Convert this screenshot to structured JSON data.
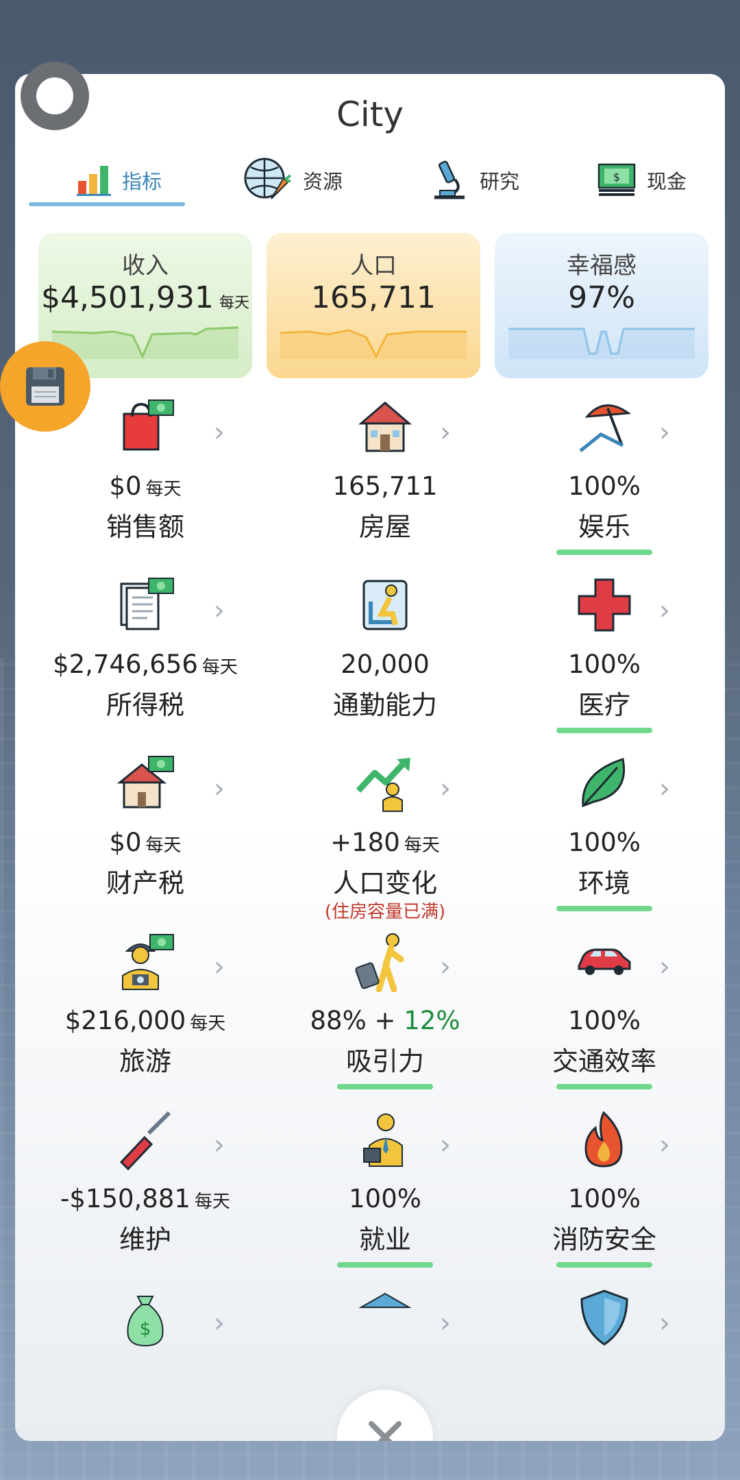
{
  "title": "City",
  "tabs": [
    {
      "label": "指标",
      "icon": "bar-chart-icon",
      "active": true
    },
    {
      "label": "资源",
      "icon": "globe-carrot-icon"
    },
    {
      "label": "研究",
      "icon": "microscope-icon"
    },
    {
      "label": "现金",
      "icon": "cash-icon"
    }
  ],
  "summary": {
    "income": {
      "label": "收入",
      "value": "$4,501,931",
      "unit": "每天"
    },
    "population": {
      "label": "人口",
      "value": "165,711"
    },
    "happiness": {
      "label": "幸福感",
      "value": "97%"
    }
  },
  "cells": [
    {
      "key": "sales",
      "icon": "shopping-bag-icon",
      "value": "$0",
      "unit": "每天",
      "label": "销售额"
    },
    {
      "key": "housing",
      "icon": "house-icon",
      "value": "165,711",
      "label": "房屋"
    },
    {
      "key": "entertainment",
      "icon": "beach-umbrella-icon",
      "value": "100%",
      "label": "娱乐",
      "bar": 1.0
    },
    {
      "key": "income-tax",
      "icon": "document-cash-icon",
      "value": "$2,746,656",
      "unit": "每天",
      "label": "所得税"
    },
    {
      "key": "commute",
      "icon": "commuter-seat-icon",
      "value": "20,000",
      "label": "通勤能力"
    },
    {
      "key": "health",
      "icon": "medical-cross-icon",
      "value": "100%",
      "label": "医疗",
      "bar": 1.0
    },
    {
      "key": "property-tax",
      "icon": "house-cash-icon",
      "value": "$0",
      "unit": "每天",
      "label": "财产税"
    },
    {
      "key": "population-change",
      "icon": "growth-arrow-icon",
      "value": "+180",
      "unit": "每天",
      "label": "人口变化",
      "warning": "(住房容量已满)"
    },
    {
      "key": "environment",
      "icon": "leaf-icon",
      "value": "100%",
      "label": "环境",
      "bar": 1.0
    },
    {
      "key": "tourism",
      "icon": "tourist-icon",
      "value": "$216,000",
      "unit": "每天",
      "label": "旅游"
    },
    {
      "key": "attraction",
      "icon": "traveler-icon",
      "value": "88% + ",
      "value_extra": "12%",
      "label": "吸引力",
      "bar": 1.0
    },
    {
      "key": "traffic",
      "icon": "car-icon",
      "value": "100%",
      "label": "交通效率",
      "bar": 1.0
    },
    {
      "key": "maintenance",
      "icon": "screwdriver-icon",
      "value": "-$150,881",
      "unit": "每天",
      "label": "维护"
    },
    {
      "key": "employment",
      "icon": "worker-icon",
      "value": "100%",
      "label": "就业",
      "bar": 1.0
    },
    {
      "key": "fire-safety",
      "icon": "fire-icon",
      "value": "100%",
      "label": "消防安全",
      "bar": 1.0
    }
  ],
  "colors": {
    "accent": "#3a86b8",
    "bar": "#6fd88b",
    "warning": "#c0392b",
    "save": "#f5a52a"
  }
}
